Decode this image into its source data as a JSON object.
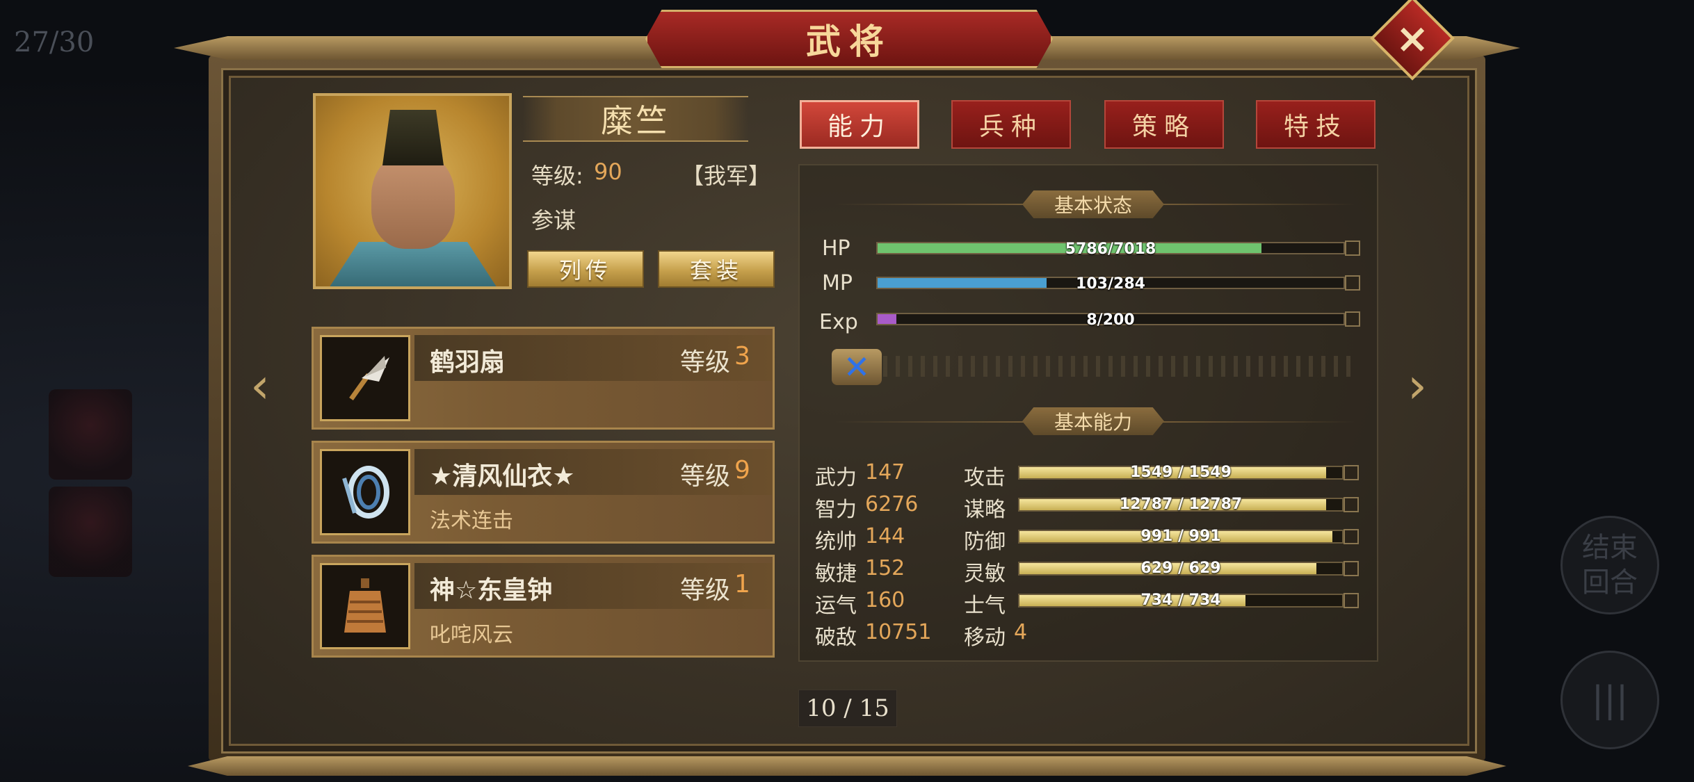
{
  "background": {
    "turn_counter": "27/30",
    "end_turn_label": "结束\n回合",
    "menu_label": "|||"
  },
  "window": {
    "title": "武将",
    "close_label": "×"
  },
  "general": {
    "name": "糜竺",
    "level_label": "等级:",
    "level_value": "90",
    "faction": "【我军】",
    "class": "参谋",
    "btn_biography": "列传",
    "btn_set": "套装"
  },
  "equipment": [
    {
      "name": "鹤羽扇",
      "level_label": "等级",
      "level": "3",
      "skill": ""
    },
    {
      "name": "★清风仙衣★",
      "level_label": "等级",
      "level": "9",
      "skill": "法术连击"
    },
    {
      "name": "神☆东皇钟",
      "level_label": "等级",
      "level": "1",
      "skill": "叱咤风云"
    }
  ],
  "tabs": [
    {
      "label": "能力",
      "active": true
    },
    {
      "label": "兵种",
      "active": false
    },
    {
      "label": "策略",
      "active": false
    },
    {
      "label": "特技",
      "active": false
    }
  ],
  "status": {
    "header": "基本状态",
    "bars": [
      {
        "label": "HP",
        "current": 5786,
        "max": 7018,
        "text": "5786/7018",
        "color": "#6fc36e"
      },
      {
        "label": "MP",
        "current": 103,
        "max": 284,
        "text": "103/284",
        "color": "#4a9fd1"
      },
      {
        "label": "Exp",
        "current": 8,
        "max": 200,
        "text": "8/200",
        "color": "#a85bc8"
      }
    ]
  },
  "ability": {
    "header": "基本能力",
    "attributes": [
      {
        "label": "武力",
        "value": "147"
      },
      {
        "label": "智力",
        "value": "6276"
      },
      {
        "label": "统帅",
        "value": "144"
      },
      {
        "label": "敏捷",
        "value": "152"
      },
      {
        "label": "运气",
        "value": "160"
      },
      {
        "label": "破敌",
        "value": "10751"
      }
    ],
    "combat": [
      {
        "label": "攻击",
        "current": 1549,
        "max": 1549,
        "text": "1549 / 1549"
      },
      {
        "label": "谋略",
        "current": 12787,
        "max": 12787,
        "text": "12787 / 12787"
      },
      {
        "label": "防御",
        "current": 991,
        "max": 991,
        "text": "991 / 991"
      },
      {
        "label": "灵敏",
        "current": 629,
        "max": 629,
        "text": "629 / 629"
      },
      {
        "label": "士气",
        "current": 734,
        "max": 734,
        "text": "734 / 734"
      }
    ],
    "move_label": "移动",
    "move_value": "4"
  },
  "pagination": {
    "text": "10 / 15"
  },
  "colors": {
    "accent_red": "#9b2a22",
    "gold": "#c9a55d",
    "value_orange": "#e4a75a"
  }
}
